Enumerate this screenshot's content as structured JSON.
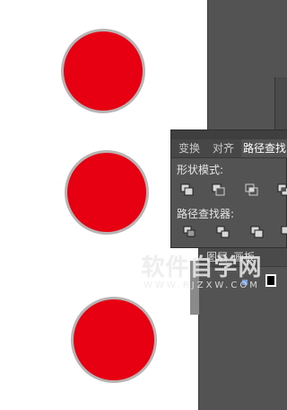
{
  "canvas": {
    "circles": [
      {
        "name": "red-circle-top",
        "fill": "#e60012"
      },
      {
        "name": "red-circle-middle",
        "fill": "#e60012"
      },
      {
        "name": "red-circle-bottom",
        "fill": "#e60012"
      }
    ],
    "stroke_color": "#b8b4b4"
  },
  "pathfinder_panel": {
    "tabs": [
      {
        "label": "变换",
        "active": false
      },
      {
        "label": "对齐",
        "active": false
      },
      {
        "label": "路径查找",
        "active": true
      }
    ],
    "shape_modes_label": "形状模式:",
    "pathfinders_label": "路径查找器:"
  },
  "lower_panel": {
    "tabs": [
      {
        "label": "图层"
      },
      {
        "label": "画板"
      }
    ]
  },
  "watermark": {
    "main": "软件自学网",
    "sub": "WWW.RJZXW.COM"
  }
}
